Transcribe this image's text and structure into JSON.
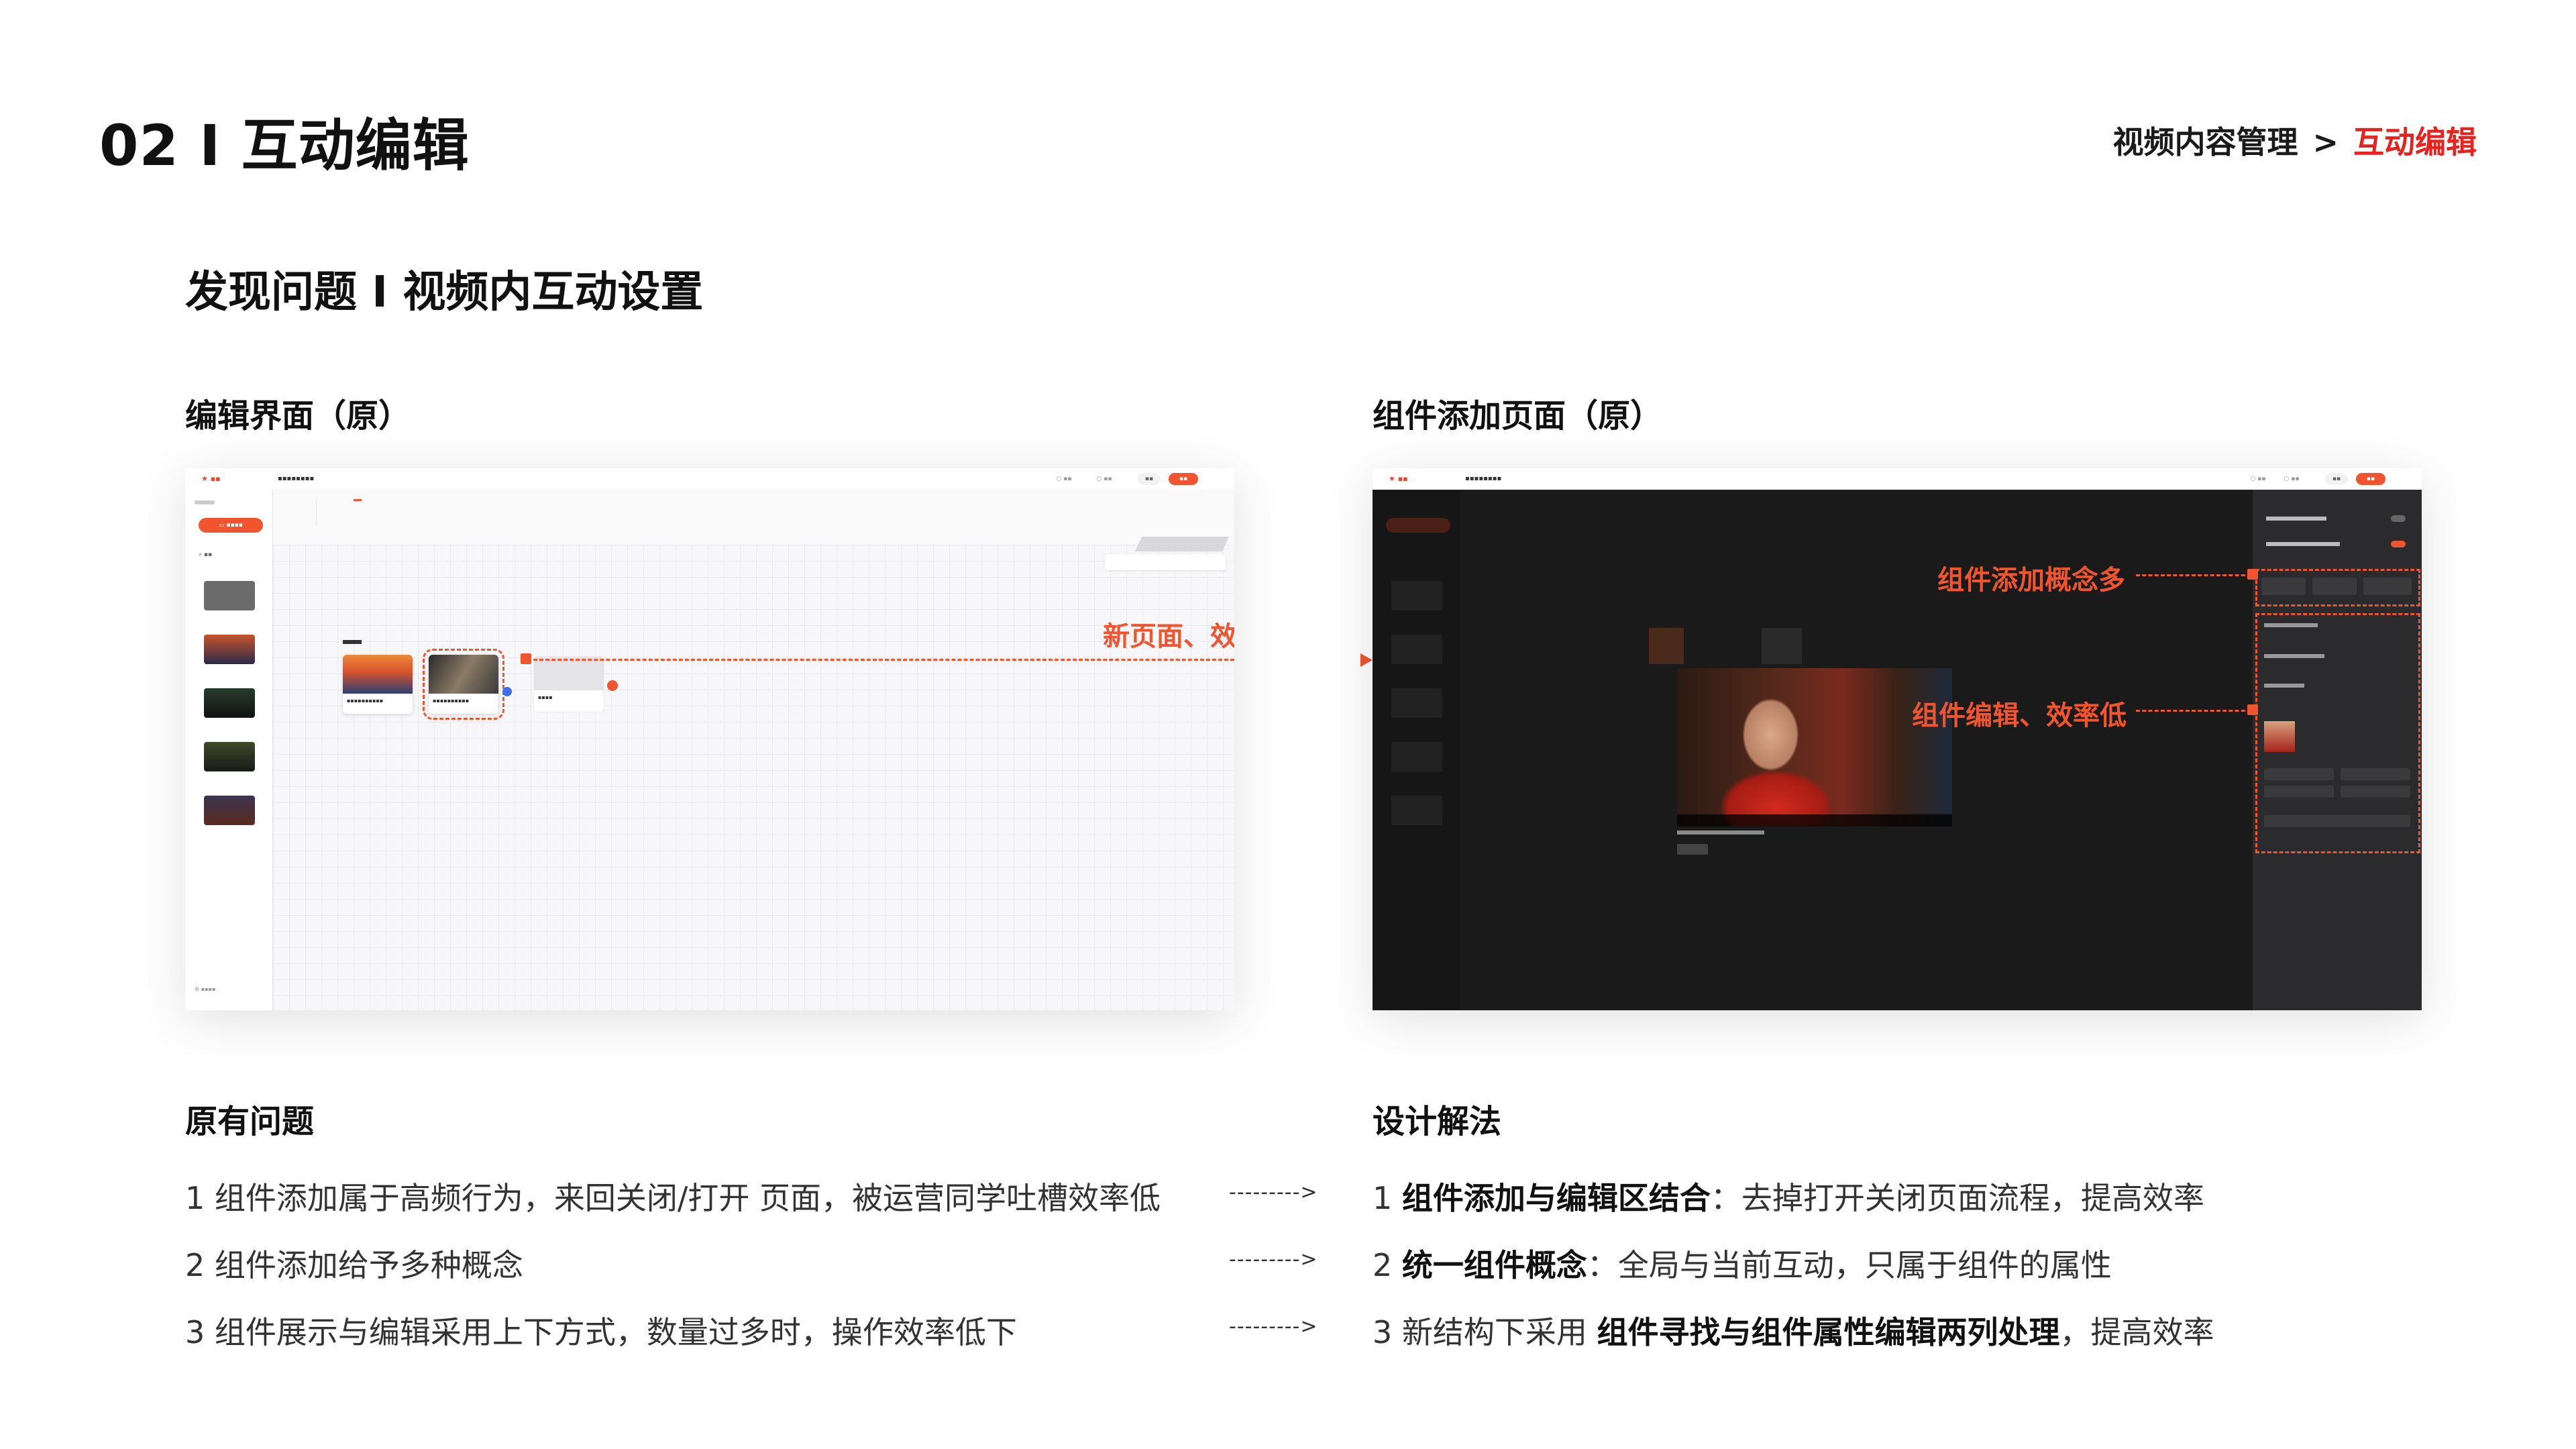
{
  "header": {
    "title": "02 I 互动编辑",
    "breadcrumb": {
      "parent": "视频内容管理",
      "separator": ">",
      "current": "互动编辑"
    }
  },
  "section_title": "发现问题 I 视频内互动设置",
  "left_shot": {
    "label": "编辑界面（原）",
    "annotation": "新页面、效率低"
  },
  "right_shot": {
    "label": "组件添加页面（原）",
    "annotations": [
      "组件添加概念多",
      "组件编辑、效率低"
    ]
  },
  "problems": {
    "title": "原有问题",
    "items": [
      "1  组件添加属于高频行为，来回关闭/打开 页面，被运营同学吐槽效率低",
      "2 组件添加给予多种概念",
      "3 组件展示与编辑采用上下方式，数量过多时，操作效率低下"
    ]
  },
  "arrow_text": "--------->",
  "solutions": {
    "title": "设计解法",
    "items": [
      {
        "prefix": "1  ",
        "bold": "组件添加与编辑区结合",
        "rest": "：去掉打开关闭页面流程，提高效率"
      },
      {
        "prefix": "2 ",
        "bold": "统一组件概念",
        "rest": "：全局与当前互动，只属于组件的属性"
      },
      {
        "prefix": "3 新结构下采用 ",
        "bold": "组件寻找与组件属性编辑两列处理",
        "rest": "，提高效率"
      }
    ]
  },
  "colors": {
    "accent": "#f0552f",
    "breadcrumb_current": "#e8231e"
  }
}
